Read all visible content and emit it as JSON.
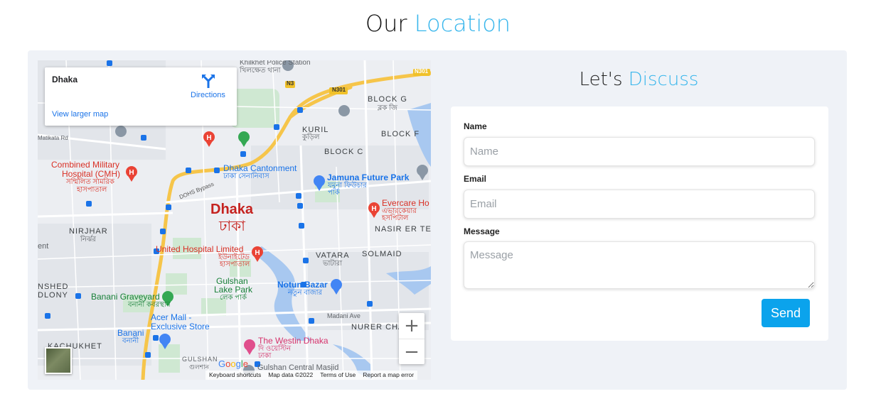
{
  "header": {
    "title_part1": "Our",
    "title_part2": "Location"
  },
  "map": {
    "info_card": {
      "title": "Dhaka",
      "directions_label": "Directions",
      "larger_map_label": "View larger map"
    },
    "labels": {
      "khilkhet_police": "Khilkhet Police Station",
      "khilkhet_police_bn": "খিলক্ষেত থানা",
      "n301_a": "N301",
      "n301_b": "N301",
      "n3": "N3",
      "block_g": "BLOCK G",
      "block_g_bn": "ব্লক জি",
      "block_f": "BLOCK F",
      "block_c": "BLOCK C",
      "kuril": "KURIL",
      "kuril_bn": "কুড়িল",
      "matikata": "Matikata Rd",
      "cmh_1": "Combined Military",
      "cmh_2": "Hospital (CMH)",
      "cmh_bn_1": "সম্মিলিত সামরিক",
      "cmh_bn_2": "হাসপাতাল",
      "cantonment": "Dhaka Cantonment",
      "cantonment_bn": "ঢাকা সেনানিবাস",
      "jamuna": "Jamuna Future Park",
      "jamuna_bn_1": "যমুনা ফিউচার",
      "jamuna_bn_2": "পার্ক",
      "dohs": "DOHS Bypass",
      "dhaka": "Dhaka",
      "dhaka_bn": "ঢাকা",
      "evercare": "Evercare Ho",
      "evercare_bn_1": "এভারকেয়ার",
      "evercare_bn_2": "হসপিটাল",
      "nirjhar": "NIRJHAR",
      "nirjhar_bn": "নির্ঝর",
      "nasirer": "NASIR ER TE",
      "ent": "ent",
      "united_1": "United Hospital Limited",
      "united_bn_1": "ইউনাইটেড",
      "united_bn_2": "হাসপাতাল",
      "vatara": "VATARA",
      "vatara_bn": "ভাটারা",
      "solmaid": "SOLMAID",
      "gulshan_lake_1": "Gulshan",
      "gulshan_lake_2": "Lake Park",
      "gulshan_lake_bn": "লেক পার্ক",
      "nshed": "NSHED",
      "dlony": "DLONY",
      "banani_grave": "Banani Graveyard",
      "banani_grave_bn": "বনানী কবরস্থান",
      "notun_bazar": "Notun Bazar",
      "notun_bazar_bn": "নতুন বাজার",
      "acer_1": "Acer Mall -",
      "acer_2": "Exclusive Store",
      "madani": "Madani Ave",
      "nurer": "NURER CHA",
      "banani": "Banani",
      "banani_bn": "বনানী",
      "kachukhet": "KACHUKHET",
      "westin": "The Westin Dhaka",
      "westin_bn_1": "দি ওয়েস্টিন",
      "westin_bn_2": "ঢাকা",
      "gulshan": "GULSHAN",
      "gulshan_bn": "গুলশান",
      "gulshan_mosque": "Gulshan Central Masjid"
    },
    "zoom_in": "+",
    "zoom_out": "−",
    "google": {
      "g": "G",
      "o1": "o",
      "o2": "o",
      "g2": "g",
      "l": "l",
      "e": "e"
    },
    "footer": {
      "shortcuts": "Keyboard shortcuts",
      "map_data": "Map data ©2022",
      "terms": "Terms of Use",
      "report": "Report a map error"
    }
  },
  "form": {
    "title_part1": "Let's",
    "title_part2": "Discuss",
    "name_label": "Name",
    "name_placeholder": "Name",
    "email_label": "Email",
    "email_placeholder": "Email",
    "message_label": "Message",
    "message_placeholder": "Message",
    "send_label": "Send"
  },
  "colors": {
    "accent": "#38b6ec",
    "send_button": "#0ba3ec",
    "panel_bg": "#eff2f7"
  },
  "icons": [
    "directions-icon",
    "hospital-pin-icon",
    "park-pin-icon",
    "shopping-pin-icon",
    "bus-stop-icon",
    "location-pin-icon",
    "satellite-thumbnail"
  ]
}
